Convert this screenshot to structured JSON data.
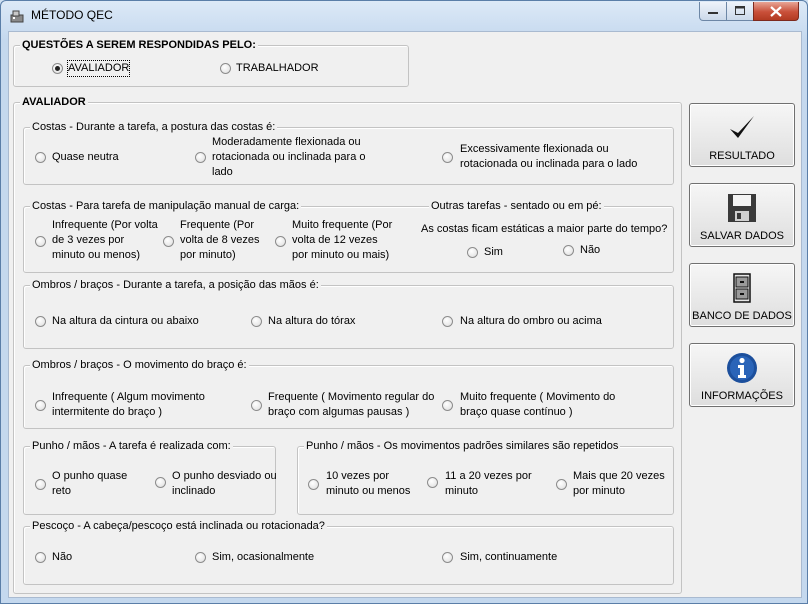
{
  "window": {
    "title": "MÉTODO QEC"
  },
  "respondent": {
    "legend": "QUESTÕES A SEREM RESPONDIDAS PELO:",
    "options": [
      "AVALIADOR",
      "TRABALHADOR"
    ],
    "selected": "AVALIADOR"
  },
  "avaliador": {
    "legend": "AVALIADOR",
    "costas_postura": {
      "legend": "Costas - Durante a tarefa, a postura das costas é:",
      "options": [
        "Quase neutra",
        "Moderadamente flexionada ou rotacionada ou inclinada para o lado",
        "Excessivamente flexionada ou rotacionada ou inclinada para o lado"
      ]
    },
    "costas_carga": {
      "legend": "Costas - Para tarefa de manipulação manual de carga:",
      "options": [
        "Infrequente (Por volta de 3 vezes por minuto ou menos)",
        "Frequente (Por volta de 8 vezes por minuto)",
        "Muito frequente (Por volta de 12 vezes por minuto ou mais)"
      ],
      "outras_title": "Outras tarefas - sentado ou em pé:",
      "outras_question": "As costas ficam estáticas a maior parte do tempo?",
      "outras_options": [
        "Sim",
        "Não"
      ]
    },
    "ombros_posicao": {
      "legend": "Ombros / braços - Durante a tarefa, a posição das mãos é:",
      "options": [
        "Na altura da cintura ou abaixo",
        "Na altura do tórax",
        "Na altura do ombro ou acima"
      ]
    },
    "ombros_movimento": {
      "legend": "Ombros / braços - O movimento do braço é:",
      "options": [
        "Infrequente ( Algum movimento intermitente do braço )",
        "Frequente ( Movimento regular do braço com algumas pausas )",
        "Muito frequente ( Movimento do braço quase contínuo )"
      ]
    },
    "punho_tarefa": {
      "legend": "Punho / mãos - A tarefa é realizada com:",
      "options": [
        "O punho quase reto",
        "O punho desviado ou inclinado"
      ]
    },
    "punho_movimentos": {
      "legend": "Punho / mãos -  Os movimentos padrões similares são repetidos",
      "options": [
        "10 vezes por minuto ou menos",
        "11 a 20 vezes por minuto",
        "Mais que 20 vezes por minuto"
      ]
    },
    "pescoco": {
      "legend": "Pescoço - A cabeça/pescoço está inclinada ou rotacionada?",
      "options": [
        "Não",
        "Sim, ocasionalmente",
        "Sim, continuamente"
      ]
    }
  },
  "buttons": {
    "resultado": {
      "label": "RESULTADO",
      "icon": "checkmark-icon"
    },
    "salvar": {
      "label": "SALVAR DADOS",
      "icon": "floppy-disk-icon"
    },
    "banco": {
      "label": "BANCO DE DADOS",
      "icon": "file-cabinet-icon"
    },
    "info": {
      "label": "INFORMAÇÕES",
      "icon": "info-icon"
    }
  },
  "colors": {
    "titlebar": "#dce9f7",
    "client": "#f0f0f0",
    "info_blue": "#1c4f9c",
    "close_red": "#c9503a"
  }
}
